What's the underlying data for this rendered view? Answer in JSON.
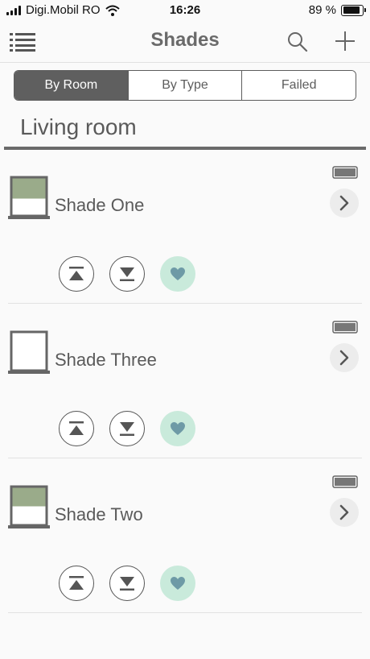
{
  "status_bar": {
    "carrier": "Digi.Mobil RO",
    "time": "16:26",
    "battery_percent": "89 %",
    "battery_level": 0.89
  },
  "nav": {
    "title": "Shades",
    "icons": [
      "menu-icon",
      "search-icon",
      "add-icon"
    ]
  },
  "tabs": [
    {
      "label": "By Room",
      "active": true
    },
    {
      "label": "By Type",
      "active": false
    },
    {
      "label": "Failed",
      "active": false
    }
  ],
  "room": {
    "name": "Living room"
  },
  "shades": [
    {
      "name": "Shade One",
      "position": "partially-closed"
    },
    {
      "name": "Shade Three",
      "position": "open"
    },
    {
      "name": "Shade Two",
      "position": "partially-closed"
    }
  ],
  "colors": {
    "accent_dark": "#5f5f5f",
    "favorite_bg": "#c9eadb",
    "favorite_icon": "#6e9aa6",
    "shade_fabric": "#9aab8a"
  }
}
